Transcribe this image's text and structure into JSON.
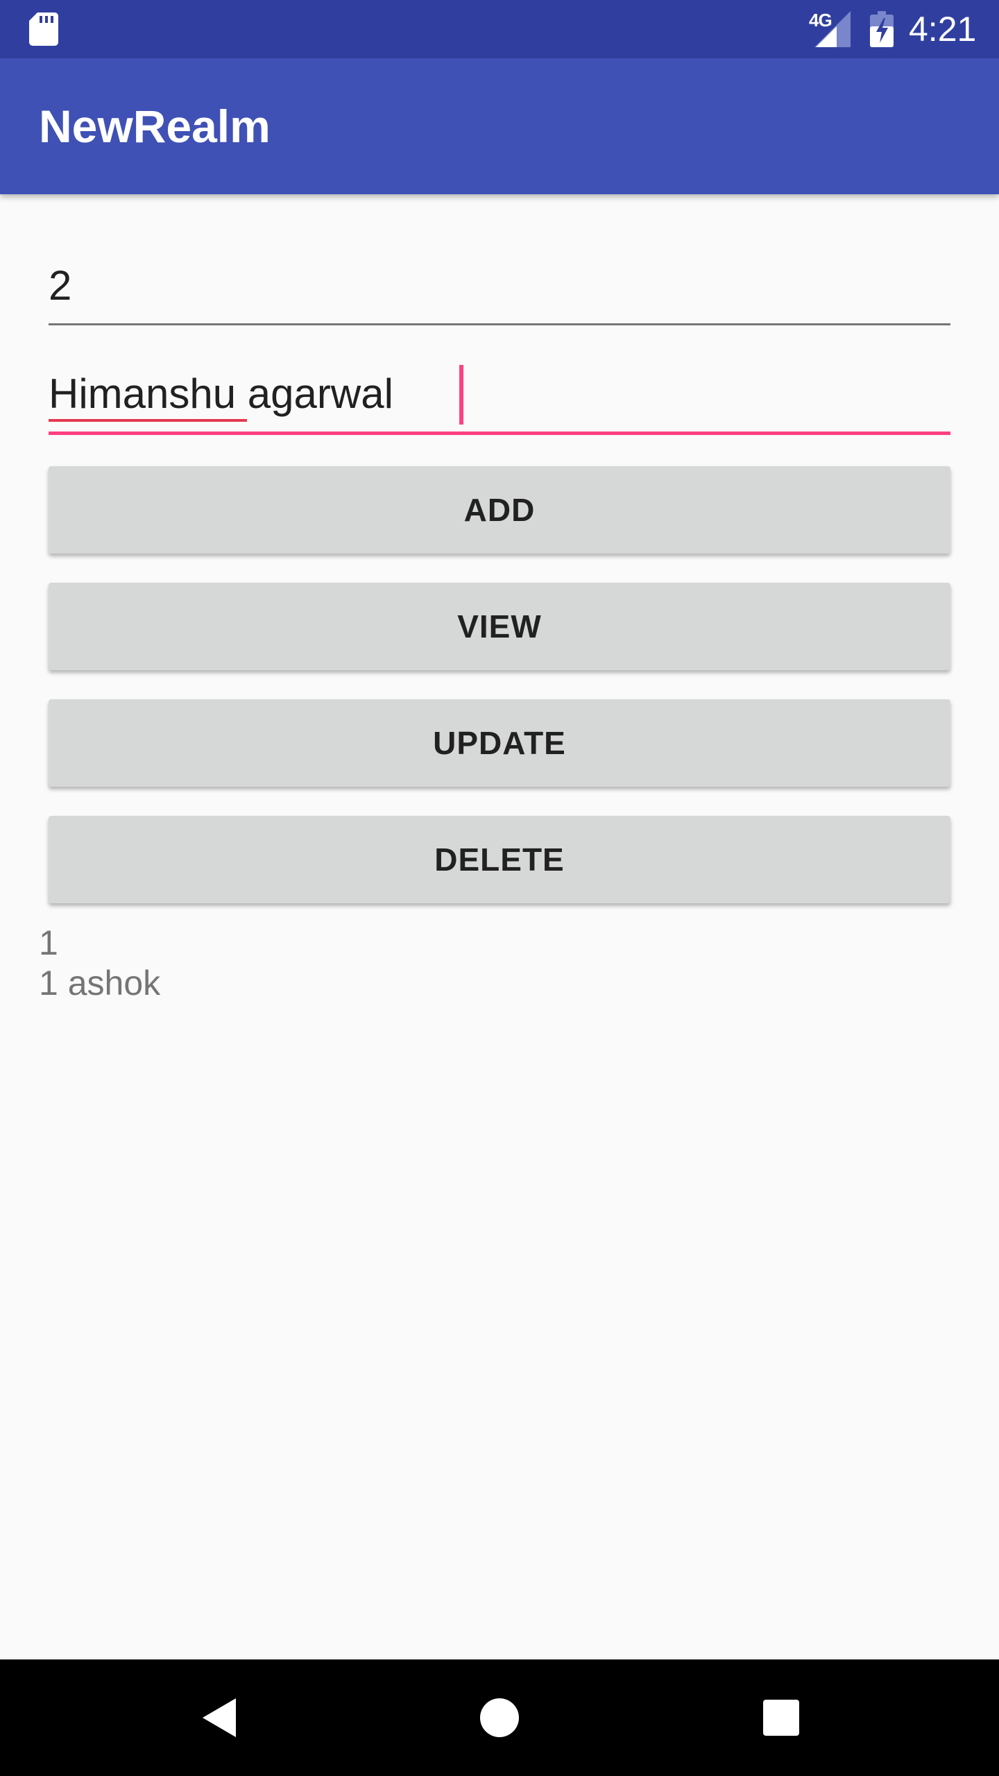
{
  "status_bar": {
    "time": "4:21",
    "network": "4G",
    "icons": [
      "sd-card-icon",
      "signal-icon",
      "battery-charging-icon"
    ]
  },
  "app_bar": {
    "title": "NewRealm"
  },
  "form": {
    "id_value": "2",
    "name_value": "Himanshu agarwal"
  },
  "buttons": {
    "add": "ADD",
    "view": "VIEW",
    "update": "UPDATE",
    "delete": "DELETE"
  },
  "result": {
    "lines": [
      "1",
      "1 ashok"
    ]
  },
  "nav_bar": {
    "icons": [
      "back-icon",
      "home-icon",
      "recents-icon"
    ]
  },
  "colors": {
    "primary": "#3F51B5",
    "primary_dark": "#303F9F",
    "accent": "#FF4081",
    "button_bg": "#D6D7D7",
    "background": "#FAFAFA"
  }
}
